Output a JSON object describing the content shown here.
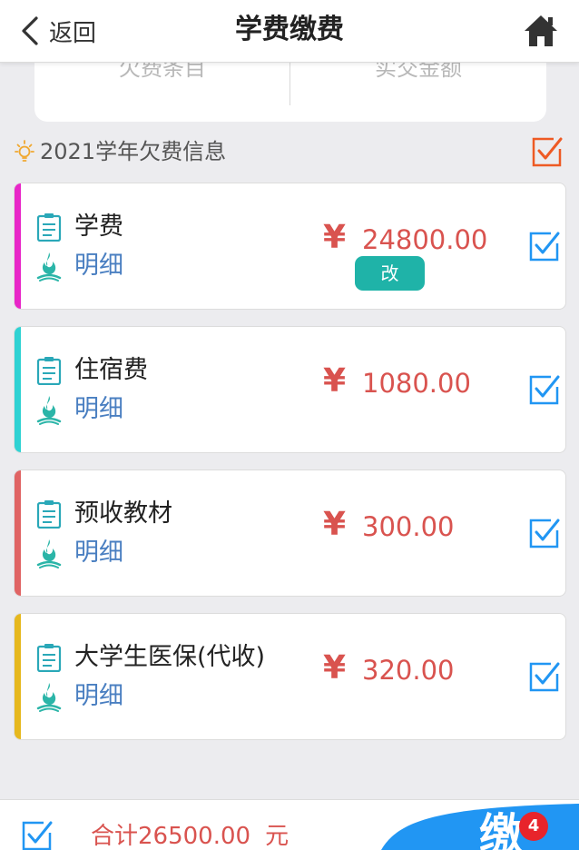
{
  "header": {
    "back_label": "返回",
    "title": "学费缴费"
  },
  "summary": {
    "left_label": "欠费条目",
    "right_label": "实交金额"
  },
  "section": {
    "title": "2021学年欠费信息"
  },
  "currency_symbol": "¥",
  "items": [
    {
      "name": "学费",
      "detail": "明细",
      "amount": "24800.00",
      "edit_label": "改",
      "accent": "#e826c8"
    },
    {
      "name": "住宿费",
      "detail": "明细",
      "amount": "1080.00",
      "accent": "#2fd2d3"
    },
    {
      "name": "预收教材",
      "detail": "明细",
      "amount": "300.00",
      "accent": "#e06464"
    },
    {
      "name": "大学生医保(代收)",
      "detail": "明细",
      "amount": "320.00",
      "accent": "#e6b81e"
    }
  ],
  "footer": {
    "total": "合计26500.00",
    "unit": "元",
    "pay_label": "缴",
    "badge": "4"
  },
  "colors": {
    "check_blue": "#2196f3",
    "check_orange": "#ee5a24",
    "teal": "#1fb3a8",
    "amount_red": "#d9534f"
  }
}
